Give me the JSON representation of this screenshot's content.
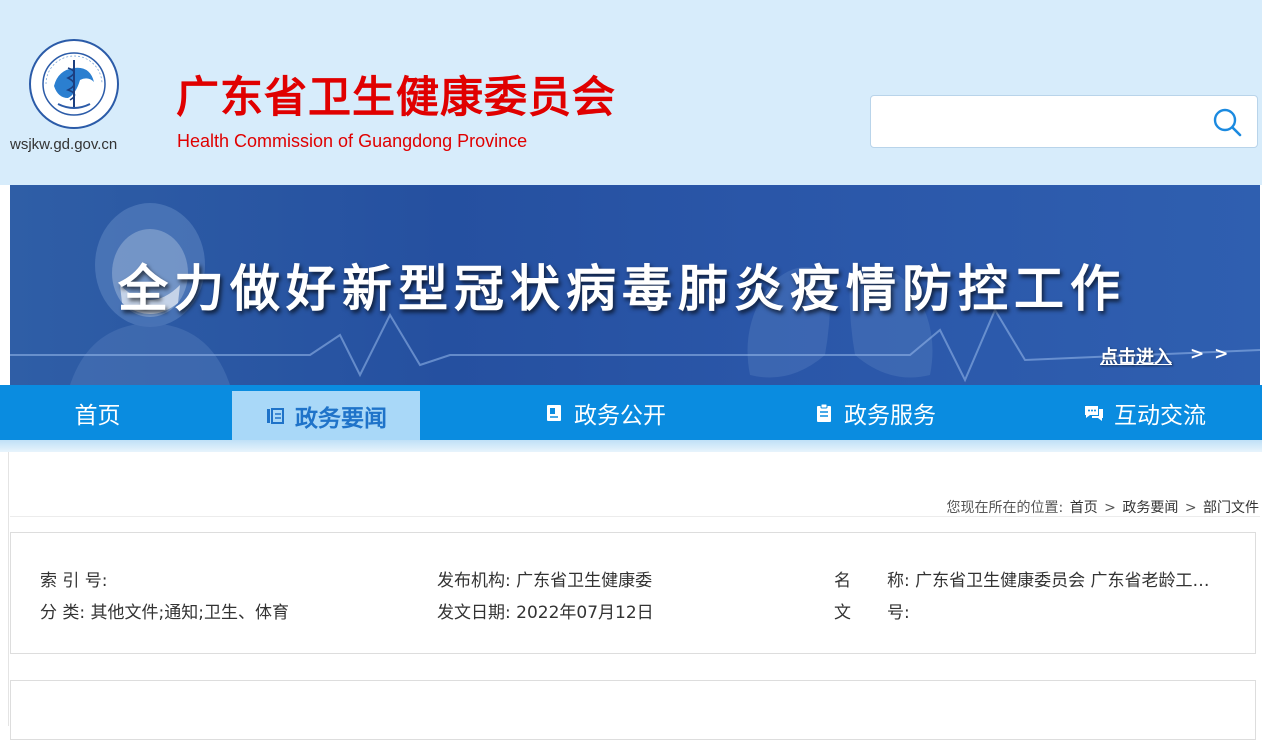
{
  "header": {
    "domain": "wsjkw.gd.gov.cn",
    "title": "广东省卫生健康委员会",
    "subtitle": "Health Commission of Guangdong Province",
    "search": {
      "value": "",
      "placeholder": ""
    },
    "colors": {
      "title": "#e00000",
      "background": "#d7ecfb"
    }
  },
  "banner": {
    "slogan": "全力做好新型冠状病毒肺炎疫情防控工作",
    "link_label": "点击进入",
    "link_arrows": "> >"
  },
  "nav": {
    "items": [
      {
        "label": "首页",
        "icon": "home",
        "active": false
      },
      {
        "label": "政务要闻",
        "icon": "news-icon",
        "active": true
      },
      {
        "label": "政务公开",
        "icon": "document-icon",
        "active": false
      },
      {
        "label": "政务服务",
        "icon": "clipboard-icon",
        "active": false
      },
      {
        "label": "互动交流",
        "icon": "chat-icon",
        "active": false
      }
    ],
    "colors": {
      "bar": "#0a8ce0",
      "active_bg": "#a9d8f8",
      "active_text": "#1f73c9"
    }
  },
  "breadcrumb": {
    "prefix": "您现在所在的位置:",
    "items": [
      "首页",
      "政务要闻",
      "部门文件"
    ],
    "separator": ">"
  },
  "meta": {
    "index_label": "索 引 号:",
    "index_value": "",
    "category_label": "分 类:",
    "category_value": "其他文件;通知;卫生、体育",
    "issuer_label": "发布机构:",
    "issuer_value": "广东省卫生健康委",
    "date_label": "发文日期:",
    "date_value": "2022年07月12日",
    "name_label_1": "名",
    "name_label_2": "称:",
    "name_value": "广东省卫生健康委员会 广东省老龄工…",
    "docno_label_1": "文",
    "docno_label_2": "号:",
    "docno_value": ""
  }
}
